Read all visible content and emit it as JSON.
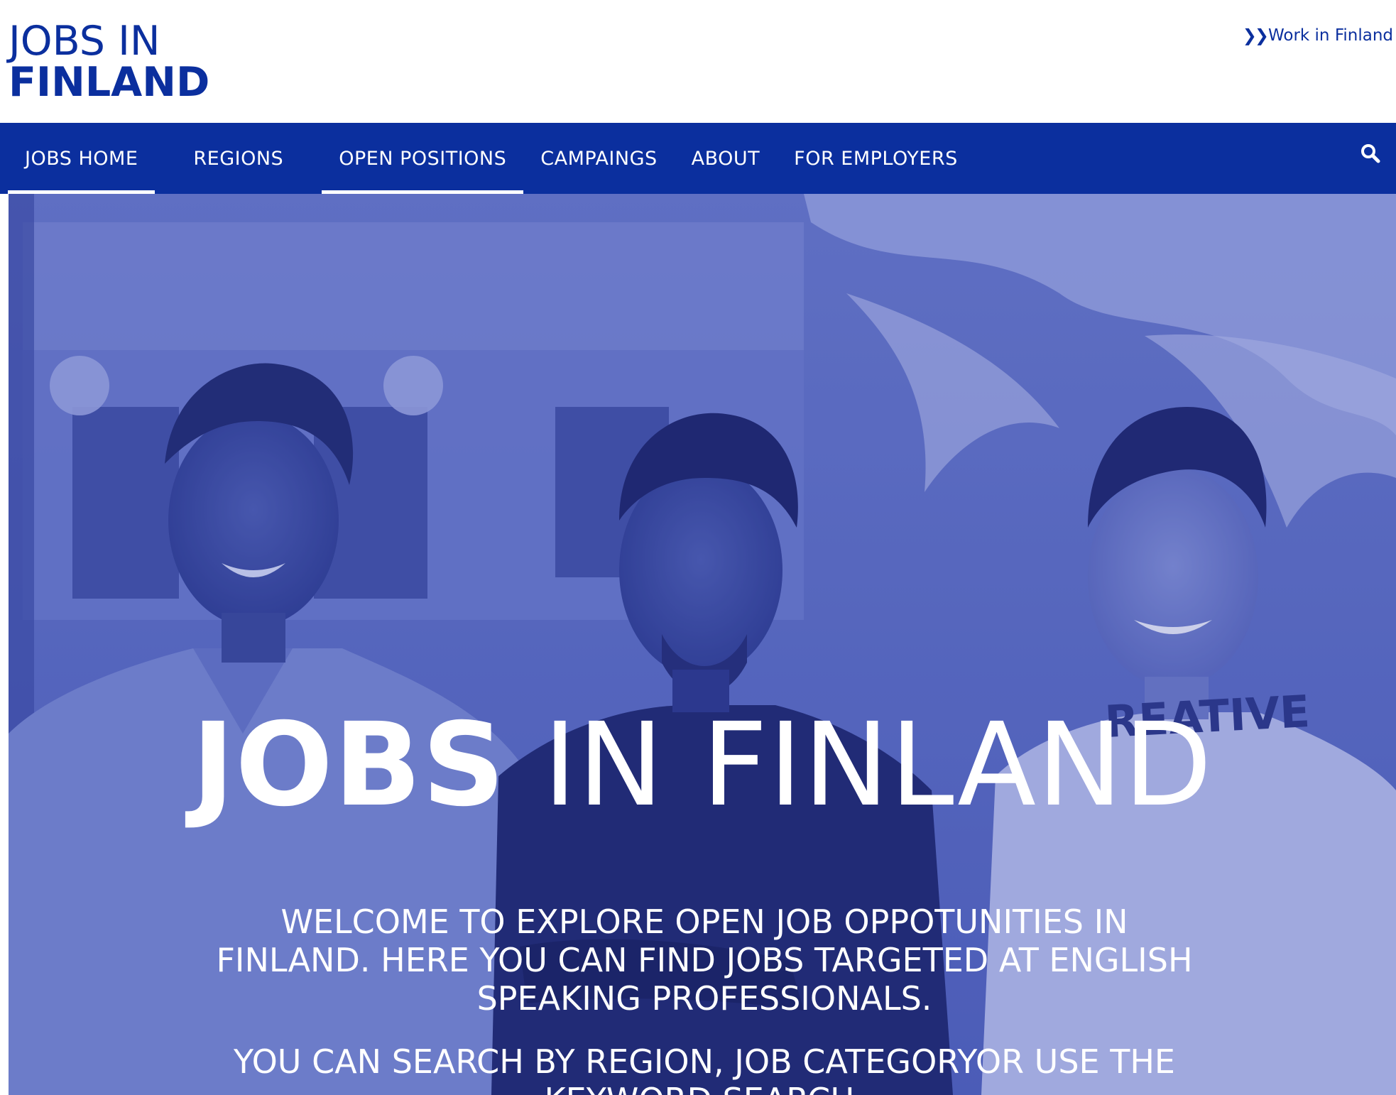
{
  "header": {
    "logo_line1": "JOBS IN",
    "logo_line2": "FINLAND",
    "work_link_label": "Work in Finland",
    "brand_color": "#0b2f9e"
  },
  "nav": {
    "items": [
      {
        "label": "JOBS HOME",
        "underlined": true
      },
      {
        "label": "REGIONS",
        "underlined": false
      },
      {
        "label": "OPEN POSITIONS",
        "underlined": true
      },
      {
        "label": "CAMPAINGS",
        "underlined": false
      },
      {
        "label": "ABOUT",
        "underlined": false
      },
      {
        "label": "FOR EMPLOYERS",
        "underlined": false
      }
    ],
    "search_icon": "search-icon"
  },
  "hero": {
    "title_bold": "JOBS",
    "title_light": " IN FINLAND",
    "paragraph1": "WELCOME TO EXPLORE OPEN JOB OPPOTUNITIES IN FINLAND. HERE YOU CAN FIND JOBS TARGETED AT ENGLISH SPEAKING PROFESSIONALS.",
    "paragraph2": "YOU CAN SEARCH BY REGION, JOB CATEGORYOR USE THE KEYWORD SEARCH.",
    "shirt_text": "REATIVE",
    "overlay_color": "#3a4fb0"
  }
}
